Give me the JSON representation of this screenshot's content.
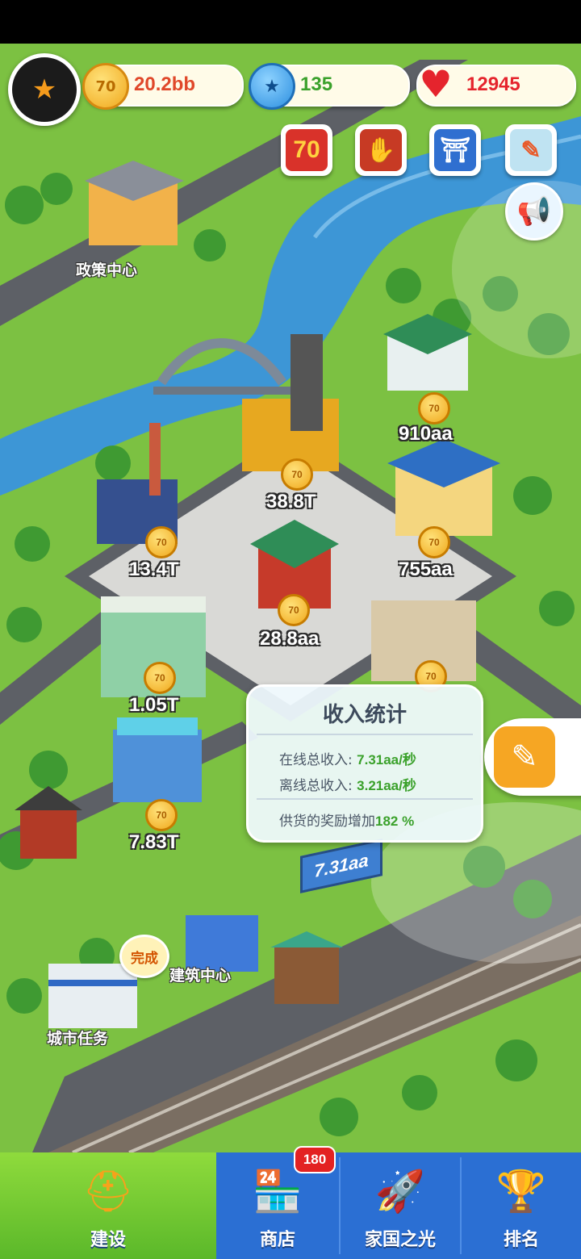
{
  "hud": {
    "coins": "20.2bb",
    "coin_icon_text": "70",
    "gems": "135",
    "hearts": "12945"
  },
  "top_buttons": [
    {
      "name": "anniversary-70-button",
      "text": "70"
    },
    {
      "name": "handshake-button",
      "text": ""
    },
    {
      "name": "tower-event-button",
      "text": ""
    },
    {
      "name": "notes-button",
      "text": ""
    }
  ],
  "places": {
    "policy_center": "政策中心",
    "building_center": "建筑中心",
    "city_task": "城市任务",
    "city_task_badge": "完成"
  },
  "building_incomes": [
    {
      "id": "b1",
      "value": "910aa"
    },
    {
      "id": "b2",
      "value": "38.8T"
    },
    {
      "id": "b3",
      "value": "13.4T"
    },
    {
      "id": "b4",
      "value": "755aa"
    },
    {
      "id": "b5",
      "value": "28.8aa"
    },
    {
      "id": "b6",
      "value": "1.05T"
    },
    {
      "id": "b7",
      "value": "7.83T"
    }
  ],
  "income_stats": {
    "title": "收入统计",
    "online_label": "在线总收入:",
    "online_value": "7.31aa/秒",
    "offline_label": "离线总收入:",
    "offline_value": "3.21aa/秒",
    "bonus_label": "供货的奖励增加",
    "bonus_value": "182 %"
  },
  "billboard": "7.31aa",
  "nav": {
    "build": "建设",
    "shop": "商店",
    "shop_badge": "180",
    "homeland": "家国之光",
    "rank": "排名"
  },
  "colors": {
    "grass": "#7cc142",
    "river": "#3d96d6",
    "road": "#5d6066",
    "nav_blue": "#2b6fd3",
    "nav_active": "#6cc632",
    "income_green": "#3aa12b"
  }
}
